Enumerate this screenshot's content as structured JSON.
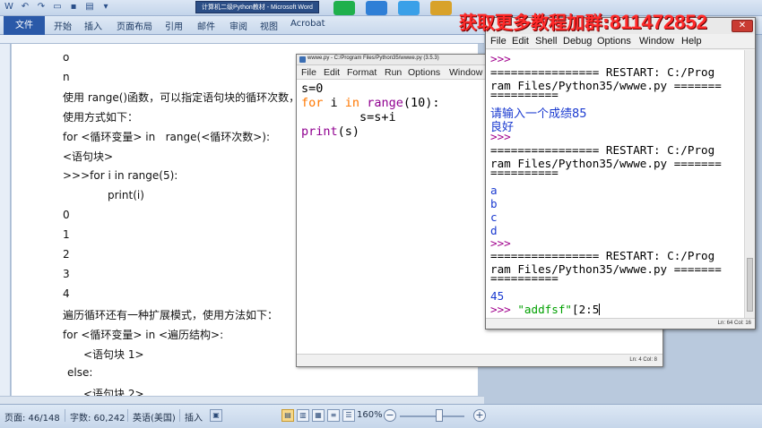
{
  "word": {
    "window_title": "计算机二级Python教材 - Microsoft Word",
    "ribbon_tabs": [
      "文件",
      "开始",
      "插入",
      "页面布局",
      "引用",
      "邮件",
      "审阅",
      "视图",
      "Acrobat"
    ],
    "doc_lines": [
      "o",
      "n",
      "使用 range()函数，可以指定语句块的循环次数，",
      "使用方式如下：",
      "for <循环变量> in   range(<循环次数>):",
      "<语句块>",
      ">>>for i in range(5):",
      "print(i)",
      "0",
      "1",
      "2",
      "3",
      "4",
      "遍历循环还有一种扩展模式，使用方法如下：",
      "for <循环变量> in <遍历结构>:",
      "<语句块 1>",
      "else:",
      "<语句块 2>"
    ],
    "status": {
      "page": "页面: 46/148",
      "words": "字数: 60,242",
      "language": "英语(美国)",
      "mode": "插入",
      "zoom": "160%"
    }
  },
  "editor": {
    "title": "wwwe.py - C:/Program Files/Python35/wwwe.py (3.5.3)",
    "menu": [
      "File",
      "Edit",
      "Format",
      "Run",
      "Options",
      "Window"
    ],
    "code": {
      "line1": "s=0",
      "line2_kw1": "for",
      "line2_mid": " i ",
      "line2_kw2": "in",
      "line2_sp": " ",
      "line2_bi": "range",
      "line2_rest": "(10):",
      "line3": "        s=s+i",
      "line4_bi": "print",
      "line4_rest": "(s)"
    },
    "status_lncol": "Ln: 4  Col: 8"
  },
  "shell": {
    "menu": [
      "File",
      "Edit",
      "Shell",
      "Debug",
      "Options",
      "Window",
      "Help"
    ],
    "lines": {
      "p1": ">>>",
      "r1a": "================ RESTART: C:/Prog",
      "r1b": "ram Files/Python35/wwwe.py =======",
      "r1c": "==========",
      "in1": "请输入一个成绩85",
      "out1": "良好",
      "p2": ">>>",
      "r2a": "================ RESTART: C:/Prog",
      "r2b": "ram Files/Python35/wwwe.py =======",
      "r2c": "==========",
      "o_a": "a",
      "o_b": "b",
      "o_c": "c",
      "o_d": "d",
      "p3": ">>>",
      "r3a": "================ RESTART: C:/Prog",
      "r3b": "ram Files/Python35/wwwe.py =======",
      "r3c": "==========",
      "out45": "45",
      "p4": ">>> ",
      "cur_str": "\"addfsf\"",
      "cur_rest": "[2:5"
    },
    "status_lncol": "Ln: 64  Col: 16"
  },
  "banner": {
    "text": "获取更多教程加群:",
    "number": "811472852",
    "color": "#ff2a2a"
  }
}
